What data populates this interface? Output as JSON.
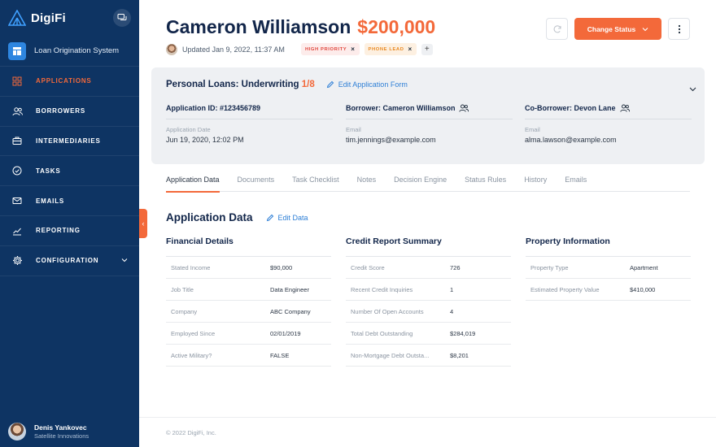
{
  "brand": {
    "name": "DigiFi"
  },
  "sidebar": {
    "product": "Loan Origination System",
    "items": [
      {
        "label": "APPLICATIONS",
        "icon": "grid-icon",
        "active": true
      },
      {
        "label": "BORROWERS",
        "icon": "users-icon"
      },
      {
        "label": "INTERMEDIARIES",
        "icon": "briefcase-icon"
      },
      {
        "label": "TASKS",
        "icon": "check-circle-icon"
      },
      {
        "label": "EMAILS",
        "icon": "mail-icon"
      },
      {
        "label": "REPORTING",
        "icon": "chart-line-icon"
      },
      {
        "label": "CONFIGURATION",
        "icon": "gear-icon"
      }
    ],
    "user": {
      "name": "Denis Yankovec",
      "org": "Satellite Innovations"
    }
  },
  "header": {
    "name": "Cameron Williamson",
    "amount": "$200,000",
    "updated": "Updated Jan 9, 2022, 11:37 AM",
    "tags": [
      "HIGH PRIORITY",
      "PHONE LEAD"
    ],
    "status_button": "Change Status"
  },
  "panel": {
    "title": "Personal Loans: Underwriting",
    "progress": "1/8",
    "edit_label": "Edit Application Form",
    "columns": [
      {
        "heading": "Application ID: #123456789",
        "label": "Application Date",
        "value": "Jun 19, 2020, 12:02 PM"
      },
      {
        "heading": "Borrower: Cameron Williamson",
        "label": "Email",
        "value": "tim.jennings@example.com"
      },
      {
        "heading": "Co-Borrower: Devon Lane",
        "label": "Email",
        "value": "alma.lawson@example.com"
      }
    ]
  },
  "tabs": [
    "Application Data",
    "Documents",
    "Task Checklist",
    "Notes",
    "Decision Engine",
    "Status Rules",
    "History",
    "Emails"
  ],
  "section": {
    "title": "Application Data",
    "edit_label": "Edit Data",
    "groups": [
      {
        "title": "Financial Details",
        "rows": [
          [
            "Stated Income",
            "$90,000"
          ],
          [
            "Job Title",
            "Data Engineer"
          ],
          [
            "Company",
            "ABC Company"
          ],
          [
            "Employed Since",
            "02/01/2019"
          ],
          [
            "Active Military?",
            "FALSE"
          ]
        ]
      },
      {
        "title": "Credit Report Summary",
        "rows": [
          [
            "Credit Score",
            "726"
          ],
          [
            "Recent Credit Inquiries",
            "1"
          ],
          [
            "Number Of Open Accounts",
            "4"
          ],
          [
            "Total Debt Outstanding",
            "$284,019"
          ],
          [
            "Non-Mortgage Debt Outsta...",
            "$8,201"
          ]
        ]
      },
      {
        "title": "Property Information",
        "rows": [
          [
            "Property Type",
            "Apartment"
          ],
          [
            "Estimated Property Value",
            "$410,000"
          ]
        ]
      }
    ]
  },
  "footer": "© 2022 DigiFi, Inc.",
  "colors": {
    "sidebar": "#0e3463",
    "accent": "#f3693a",
    "link": "#2e7fd6"
  }
}
